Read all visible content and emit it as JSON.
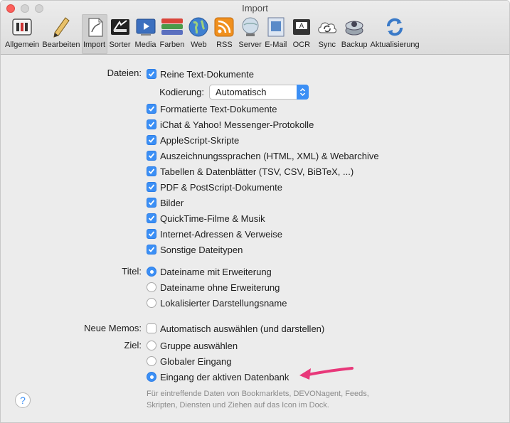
{
  "window": {
    "title": "Import"
  },
  "toolbar": [
    {
      "label": "Allgemein",
      "icon": "switches-icon",
      "active": false
    },
    {
      "label": "Bearbeiten",
      "icon": "pencil-icon",
      "active": false
    },
    {
      "label": "Import",
      "icon": "import-document-icon",
      "active": true
    },
    {
      "label": "Sorter",
      "icon": "sorter-icon",
      "active": false
    },
    {
      "label": "Media",
      "icon": "media-icon",
      "active": false
    },
    {
      "label": "Farben",
      "icon": "colors-icon",
      "active": false
    },
    {
      "label": "Web",
      "icon": "globe-icon",
      "active": false
    },
    {
      "label": "RSS",
      "icon": "rss-icon",
      "active": false
    },
    {
      "label": "Server",
      "icon": "server-icon",
      "active": false
    },
    {
      "label": "E-Mail",
      "icon": "email-icon",
      "active": false
    },
    {
      "label": "OCR",
      "icon": "ocr-scanner-icon",
      "active": false
    },
    {
      "label": "Sync",
      "icon": "sync-cloud-icon",
      "active": false
    },
    {
      "label": "Backup",
      "icon": "backup-icon",
      "active": false
    },
    {
      "label": "Aktualisierung",
      "icon": "update-icon",
      "active": false
    }
  ],
  "files": {
    "label": "Dateien:",
    "plain_text": "Reine Text-Dokumente",
    "encoding_label": "Kodierung:",
    "encoding_value": "Automatisch",
    "items": [
      {
        "label": "Formatierte Text-Dokumente",
        "checked": true
      },
      {
        "label": "iChat & Yahoo! Messenger-Protokolle",
        "checked": true
      },
      {
        "label": "AppleScript-Skripte",
        "checked": true
      },
      {
        "label": "Auszeichnungssprachen (HTML, XML) & Webarchive",
        "checked": true
      },
      {
        "label": "Tabellen & Datenblätter (TSV, CSV, BiBTeX, ...)",
        "checked": true
      },
      {
        "label": "PDF & PostScript-Dokumente",
        "checked": true
      },
      {
        "label": "Bilder",
        "checked": true
      },
      {
        "label": "QuickTime-Filme & Musik",
        "checked": true
      },
      {
        "label": "Internet-Adressen & Verweise",
        "checked": true
      },
      {
        "label": "Sonstige Dateitypen",
        "checked": true
      }
    ]
  },
  "title_section": {
    "label": "Titel:",
    "options": [
      {
        "label": "Dateiname mit Erweiterung",
        "selected": true
      },
      {
        "label": "Dateiname ohne Erweiterung",
        "selected": false
      },
      {
        "label": "Lokalisierter Darstellungsname",
        "selected": false
      }
    ]
  },
  "memos": {
    "label": "Neue Memos:",
    "auto_select": "Automatisch auswählen (und darstellen)",
    "auto_checked": false
  },
  "target": {
    "label": "Ziel:",
    "options": [
      {
        "label": "Gruppe auswählen",
        "selected": false
      },
      {
        "label": "Globaler Eingang",
        "selected": false
      },
      {
        "label": "Eingang der aktiven Datenbank",
        "selected": true
      }
    ],
    "hint_line1": "Für eintreffende Daten von Bookmarklets, DEVONagent, Feeds,",
    "hint_line2": "Skripten, Diensten und Ziehen auf das Icon im Dock."
  },
  "help": {
    "glyph": "?"
  },
  "colors": {
    "accent": "#3b8ff5",
    "arrow": "#e8387a"
  }
}
